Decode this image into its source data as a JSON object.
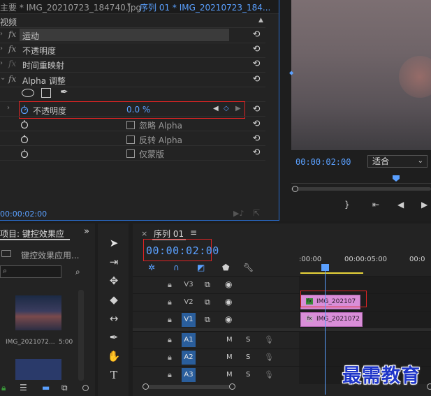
{
  "effect_controls": {
    "source_tab": "主要 * IMG_20210723_184740.jpg",
    "sequence_tab": "序列 01 * IMG_20210723_184...",
    "section_label": "视频",
    "fx_label": "fx",
    "props": {
      "motion": "运动",
      "opacity": "不透明度",
      "time_remap": "时间重映射",
      "alpha_adjust": "Alpha 调整",
      "sub_opacity": "不透明度",
      "opacity_value": "0.0 %",
      "ignore_alpha": "忽略 Alpha",
      "invert_alpha": "反转 Alpha",
      "mask_only": "仅蒙版"
    },
    "timecode": "00:00:02:00"
  },
  "program_monitor": {
    "timecode": "00:00:02:00",
    "fit_option": "适合"
  },
  "project": {
    "tab_label": "项目: 键控效果应",
    "path": "键控效果应用...",
    "clip_name": "IMG_2021072...",
    "clip_duration": "5:00"
  },
  "timeline": {
    "tab_label": "序列 01",
    "timecode": "00:00:02:00",
    "ruler": [
      ":00:00",
      "00:00:05:00",
      "00:0"
    ],
    "tracks": [
      {
        "name": "V3",
        "kind": "video",
        "active": false
      },
      {
        "name": "V2",
        "kind": "video",
        "active": false
      },
      {
        "name": "V1",
        "kind": "video",
        "active": true
      },
      {
        "name": "A1",
        "kind": "audio",
        "active": true
      },
      {
        "name": "A2",
        "kind": "audio",
        "active": true
      },
      {
        "name": "A3",
        "kind": "audio",
        "active": true
      }
    ],
    "audio_m": "M",
    "audio_s": "S",
    "clip_v2": "IMG_202107",
    "clip_v1": "IMG_2021072",
    "fx_badge": "fx"
  },
  "watermark": "最需教育",
  "colors": {
    "accent_blue": "#5aa0ff",
    "highlight_red": "#e02424",
    "clip_pink": "#d98ed8",
    "work_area_yellow": "#e8d43a"
  }
}
